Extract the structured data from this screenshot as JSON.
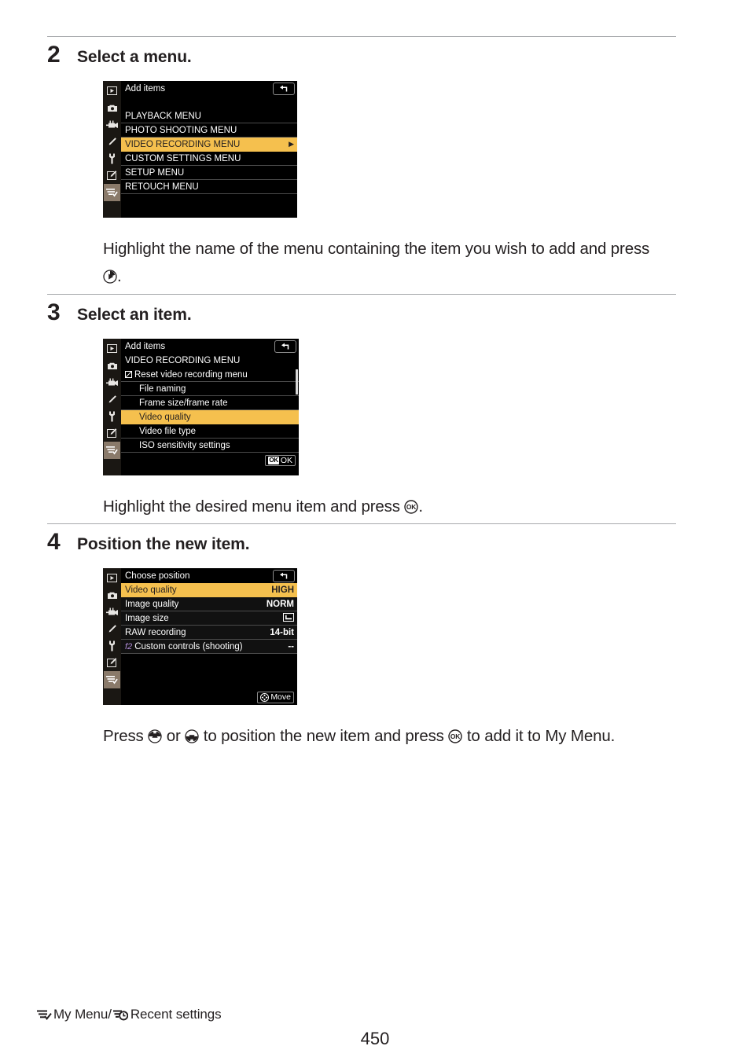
{
  "page": {
    "number": "450",
    "footer_tab": {
      "my_menu_label": "My Menu/",
      "recent_label": "Recent settings",
      "my_menu_icon": "my-menu-icon",
      "recent_icon": "recent-settings-clock-icon"
    }
  },
  "steps": [
    {
      "number": "2",
      "title": "Select a menu.",
      "body_before": "Highlight the name of the menu containing the item you wish to add and press ",
      "body_icon": "multi-selector-right-icon",
      "body_after": ".",
      "screen": {
        "title": "Add items",
        "back_icon": "return-arrow-icon",
        "subtitle": "",
        "footer_badge": "",
        "rows": [
          {
            "label": "PLAYBACK MENU",
            "value": "",
            "selected": false,
            "caret": false
          },
          {
            "label": "PHOTO SHOOTING MENU",
            "value": "",
            "selected": false,
            "caret": false
          },
          {
            "label": "VIDEO RECORDING MENU",
            "value": "",
            "selected": true,
            "caret": true
          },
          {
            "label": "CUSTOM SETTINGS MENU",
            "value": "",
            "selected": false,
            "caret": false
          },
          {
            "label": "SETUP MENU",
            "value": "",
            "selected": false,
            "caret": false
          },
          {
            "label": "RETOUCH MENU",
            "value": "",
            "selected": false,
            "caret": false
          }
        ]
      }
    },
    {
      "number": "3",
      "title": "Select an item.",
      "body_before": "Highlight the desired menu item and press ",
      "body_icon": "ok-button-icon",
      "body_after": ".",
      "screen": {
        "title": "Add items",
        "back_icon": "return-arrow-icon",
        "subtitle": "VIDEO RECORDING MENU",
        "footer_badge": "OK",
        "rows": [
          {
            "label": "Reset video recording menu",
            "value": "",
            "selected": false,
            "reset_icon": true
          },
          {
            "label": "File naming",
            "value": "",
            "selected": false
          },
          {
            "label": "Frame size/frame rate",
            "value": "",
            "selected": false
          },
          {
            "label": "Video quality",
            "value": "",
            "selected": true
          },
          {
            "label": "Video file type",
            "value": "",
            "selected": false
          },
          {
            "label": "ISO sensitivity settings",
            "value": "",
            "selected": false
          }
        ]
      }
    },
    {
      "number": "4",
      "title": "Position the new item.",
      "body_before": "Press ",
      "body_icon": "multi-selector-up-icon",
      "body_mid1": " or ",
      "body_icon2": "multi-selector-down-icon",
      "body_mid2": " to position the new item and press ",
      "body_icon3": "ok-button-icon",
      "body_after": " to add it to My Menu.",
      "screen": {
        "title": "Choose position",
        "back_icon": "return-arrow-icon",
        "subtitle": "",
        "footer_badge": "Move",
        "rows": [
          {
            "label": "Video quality",
            "value": "HIGH",
            "selected": true
          },
          {
            "label": "Image quality",
            "value": "NORM",
            "selected": false
          },
          {
            "label": "Image size",
            "value": "image-size-L-icon",
            "value_is_icon": true,
            "selected": false
          },
          {
            "label": "RAW recording",
            "value": "14-bit",
            "selected": false
          },
          {
            "label": "Custom controls (shooting)",
            "value": "--",
            "selected": false,
            "prefix": "f2"
          }
        ]
      }
    }
  ],
  "rail_icons": [
    "playback-icon",
    "photo-shooting-icon",
    "video-recording-icon",
    "custom-settings-pencil-icon",
    "setup-wrench-icon",
    "retouch-icon",
    "my-menu-icon"
  ],
  "colors": {
    "highlight": "#f5c04e",
    "rule": "#a7a9ac",
    "text": "#231f20",
    "lcd_bg": "#000000",
    "rail_bg": "#1a1713",
    "rail_active": "#8a7a6a",
    "f_number": "#b08cd8"
  }
}
